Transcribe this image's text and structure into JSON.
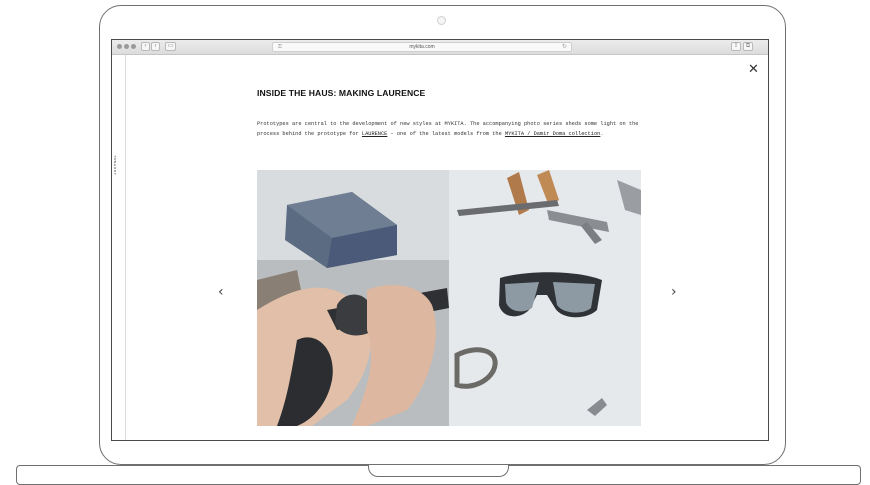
{
  "browser": {
    "url": "mykita.com",
    "lock_glyph": "⚿",
    "reload_glyph": "↻",
    "back_glyph": "‹",
    "forward_glyph": "›",
    "sidebar_glyph": "▭",
    "share_glyph": "⇪",
    "tabs_glyph": "⧉"
  },
  "page": {
    "side_label": "JOURNAL",
    "close_glyph": "✕",
    "title": "INSIDE THE HAUS: MAKING LAURENCE",
    "intro": {
      "part1": "Prototypes are central to the development of new styles at MYKITA. The accompanying photo series sheds some light on the process behind the prototype for ",
      "link1": "LAURENCE",
      "part2": " – one of the latest models from the ",
      "link2": "MYKITA / Damir Doma collection",
      "part3": "."
    },
    "prev_glyph": "‹",
    "next_glyph": "›"
  },
  "icons": {
    "close": "close-icon",
    "prev": "chevron-left-icon",
    "next": "chevron-right-icon"
  }
}
